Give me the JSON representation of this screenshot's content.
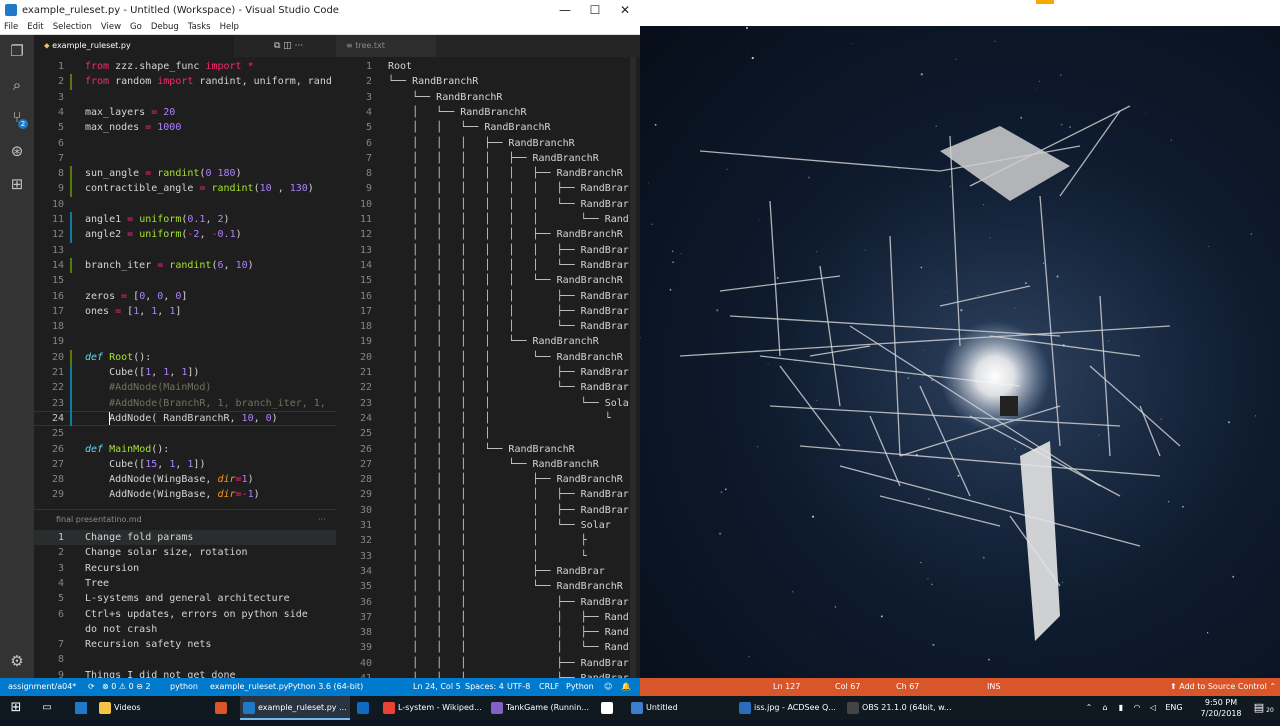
{
  "vscode": {
    "title": "example_ruleset.py - Untitled (Workspace) - Visual Studio Code",
    "win_buttons": [
      "—",
      "☐",
      "✕"
    ],
    "menu": [
      "File",
      "Edit",
      "Selection",
      "View",
      "Go",
      "Debug",
      "Tasks",
      "Help"
    ],
    "scm_badge": "2",
    "tabs": {
      "left": "example_ruleset.py",
      "right": "tree.txt",
      "left_actions": "⧉  ◫  ···"
    },
    "editor_lines": [
      {
        "n": "1",
        "t": [
          [
            "kw",
            "from "
          ],
          [
            "",
            "zzz.shape_func "
          ],
          [
            "kw",
            "import "
          ],
          [
            "kw",
            "*"
          ]
        ]
      },
      {
        "n": "2",
        "t": [
          [
            "kw",
            "from "
          ],
          [
            "",
            "random "
          ],
          [
            "kw",
            "import "
          ],
          [
            "",
            "randint, uniform, rand"
          ]
        ]
      },
      {
        "n": "3",
        "t": []
      },
      {
        "n": "4",
        "t": [
          [
            "",
            "max_layers "
          ],
          [
            "kw",
            "= "
          ],
          [
            "num",
            "20"
          ]
        ]
      },
      {
        "n": "5",
        "t": [
          [
            "",
            "max_nodes "
          ],
          [
            "kw",
            "= "
          ],
          [
            "num",
            "1000"
          ]
        ]
      },
      {
        "n": "6",
        "t": []
      },
      {
        "n": "7",
        "t": []
      },
      {
        "n": "8",
        "t": [
          [
            "",
            "sun_angle "
          ],
          [
            "kw",
            "= "
          ],
          [
            "fn",
            "randint"
          ],
          [
            "",
            "("
          ],
          [
            "num",
            "0"
          ],
          [
            ",",
            " "
          ],
          [
            "num",
            "180"
          ],
          [
            "",
            ")"
          ]
        ]
      },
      {
        "n": "9",
        "t": [
          [
            "",
            "contractible_angle "
          ],
          [
            "kw",
            "= "
          ],
          [
            "fn",
            "randint"
          ],
          [
            "",
            "("
          ],
          [
            "num",
            "10"
          ],
          [
            "",
            " , "
          ],
          [
            "num",
            "130"
          ],
          [
            "",
            ")"
          ]
        ]
      },
      {
        "n": "10",
        "t": []
      },
      {
        "n": "11",
        "t": [
          [
            "",
            "angle1 "
          ],
          [
            "kw",
            "= "
          ],
          [
            "fn",
            "uniform"
          ],
          [
            "",
            "("
          ],
          [
            "num",
            "0.1"
          ],
          [
            "",
            ", "
          ],
          [
            "num",
            "2"
          ],
          [
            "",
            ")"
          ]
        ]
      },
      {
        "n": "12",
        "t": [
          [
            "",
            "angle2 "
          ],
          [
            "kw",
            "= "
          ],
          [
            "fn",
            "uniform"
          ],
          [
            "",
            "("
          ],
          [
            "kw",
            "-"
          ],
          [
            "num",
            "2"
          ],
          [
            "",
            ", "
          ],
          [
            "kw",
            "-"
          ],
          [
            "num",
            "0.1"
          ],
          [
            "",
            ")"
          ]
        ]
      },
      {
        "n": "13",
        "t": []
      },
      {
        "n": "14",
        "t": [
          [
            "",
            "branch_iter "
          ],
          [
            "kw",
            "= "
          ],
          [
            "fn",
            "randint"
          ],
          [
            "",
            "("
          ],
          [
            "num",
            "6"
          ],
          [
            "",
            ", "
          ],
          [
            "num",
            "10"
          ],
          [
            "",
            ")"
          ]
        ]
      },
      {
        "n": "15",
        "t": []
      },
      {
        "n": "16",
        "t": [
          [
            "",
            "zeros "
          ],
          [
            "kw",
            "= "
          ],
          [
            "",
            "["
          ],
          [
            "num",
            "0"
          ],
          [
            "",
            ", "
          ],
          [
            "num",
            "0"
          ],
          [
            "",
            ", "
          ],
          [
            "num",
            "0"
          ],
          [
            "",
            "]"
          ]
        ]
      },
      {
        "n": "17",
        "t": [
          [
            "",
            "ones "
          ],
          [
            "kw",
            "= "
          ],
          [
            "",
            "["
          ],
          [
            "num",
            "1"
          ],
          [
            "",
            ", "
          ],
          [
            "num",
            "1"
          ],
          [
            "",
            ", "
          ],
          [
            "num",
            "1"
          ],
          [
            "",
            "]"
          ]
        ]
      },
      {
        "n": "18",
        "t": []
      },
      {
        "n": "19",
        "t": []
      },
      {
        "n": "20",
        "t": [
          [
            "df",
            "def "
          ],
          [
            "fn",
            "Root"
          ],
          [
            "",
            "():"
          ]
        ]
      },
      {
        "n": "21",
        "t": [
          [
            "",
            "    Cube(["
          ],
          [
            "num",
            "1"
          ],
          [
            "",
            ", "
          ],
          [
            "num",
            "1"
          ],
          [
            "",
            ", "
          ],
          [
            "num",
            "1"
          ],
          [
            "",
            "])"
          ]
        ]
      },
      {
        "n": "22",
        "t": [
          [
            "cm",
            "    #AddNode(MainMod)"
          ]
        ]
      },
      {
        "n": "23",
        "t": [
          [
            "cm",
            "    #AddNode(BranchR, 1, branch_iter, 1,"
          ]
        ]
      },
      {
        "n": "24",
        "t": [
          [
            "",
            "    AddNode( RandBranchR, "
          ],
          [
            "num",
            "10"
          ],
          [
            "",
            ", "
          ],
          [
            "num",
            "0"
          ],
          [
            "",
            ")"
          ]
        ]
      },
      {
        "n": "25",
        "t": []
      },
      {
        "n": "26",
        "t": [
          [
            "df",
            "def "
          ],
          [
            "fn",
            "MainMod"
          ],
          [
            "",
            "():"
          ]
        ]
      },
      {
        "n": "27",
        "t": [
          [
            "",
            "    Cube(["
          ],
          [
            "num",
            "15"
          ],
          [
            "",
            ", "
          ],
          [
            "num",
            "1"
          ],
          [
            "",
            ", "
          ],
          [
            "num",
            "1"
          ],
          [
            "",
            "])"
          ]
        ]
      },
      {
        "n": "28",
        "t": [
          [
            "",
            "    AddNode(WingBase, "
          ],
          [
            "pm",
            "dir"
          ],
          [
            "kw",
            "="
          ],
          [
            "num",
            "1"
          ],
          [
            "",
            ")"
          ]
        ]
      },
      {
        "n": "29",
        "t": [
          [
            "",
            "    AddNode(WingBase, "
          ],
          [
            "pm",
            "dir"
          ],
          [
            "kw",
            "=-"
          ],
          [
            "num",
            "1"
          ],
          [
            "",
            ")"
          ]
        ]
      }
    ],
    "md_panel": {
      "title": "final presentatino.md",
      "actions": "···",
      "lines": [
        {
          "n": "1",
          "t": "Change fold params"
        },
        {
          "n": "2",
          "t": "Change solar size, rotation"
        },
        {
          "n": "3",
          "t": "Recursion"
        },
        {
          "n": "4",
          "t": "Tree"
        },
        {
          "n": "5",
          "t": "L-systems and general architecture"
        },
        {
          "n": "6",
          "t": "Ctrl+s updates, errors on python side"
        },
        {
          "n": "",
          "t": "do not crash"
        },
        {
          "n": "7",
          "t": "Recursion safety nets"
        },
        {
          "n": "8",
          "t": ""
        },
        {
          "n": "9",
          "t": "Things I did not get done"
        }
      ]
    },
    "tree_lines": [
      {
        "n": "1",
        "p": "",
        "t": "Root"
      },
      {
        "n": "2",
        "p": "└── ",
        "t": "RandBranchR"
      },
      {
        "n": "3",
        "p": "    └── ",
        "t": "RandBranchR"
      },
      {
        "n": "4",
        "p": "    │   └── ",
        "t": "RandBranchR"
      },
      {
        "n": "5",
        "p": "    │   │   └── ",
        "t": "RandBranchR"
      },
      {
        "n": "6",
        "p": "    │   │   │   ├── ",
        "t": "RandBranchR"
      },
      {
        "n": "7",
        "p": "    │   │   │   │   ├── ",
        "t": "RandBranchR"
      },
      {
        "n": "8",
        "p": "    │   │   │   │   │   ├── ",
        "t": "RandBranchR"
      },
      {
        "n": "9",
        "p": "    │   │   │   │   │   │   ├── ",
        "t": "RandBrar"
      },
      {
        "n": "10",
        "p": "    │   │   │   │   │   │   └── ",
        "t": "RandBrar"
      },
      {
        "n": "11",
        "p": "    │   │   │   │   │   │       └── ",
        "t": "RandI"
      },
      {
        "n": "12",
        "p": "    │   │   │   │   │   ├── ",
        "t": "RandBranchR"
      },
      {
        "n": "13",
        "p": "    │   │   │   │   │   │   ├── ",
        "t": "RandBrar"
      },
      {
        "n": "14",
        "p": "    │   │   │   │   │   │   └── ",
        "t": "RandBrar"
      },
      {
        "n": "15",
        "p": "    │   │   │   │   │   └── ",
        "t": "RandBranchR"
      },
      {
        "n": "16",
        "p": "    │   │   │   │   │       ├── ",
        "t": "RandBrar"
      },
      {
        "n": "17",
        "p": "    │   │   │   │   │       ├── ",
        "t": "RandBrar"
      },
      {
        "n": "18",
        "p": "    │   │   │   │   │       └── ",
        "t": "RandBrar"
      },
      {
        "n": "19",
        "p": "    │   │   │   │   └── ",
        "t": "RandBranchR"
      },
      {
        "n": "20",
        "p": "    │   │   │   │       └── ",
        "t": "RandBranchR"
      },
      {
        "n": "21",
        "p": "    │   │   │   │           ├── ",
        "t": "RandBrar"
      },
      {
        "n": "22",
        "p": "    │   │   │   │           └── ",
        "t": "RandBrar"
      },
      {
        "n": "23",
        "p": "    │   │   │   │               └── ",
        "t": "Solar"
      },
      {
        "n": "24",
        "p": "    │   │   │   │                   └",
        "t": ""
      },
      {
        "n": "25",
        "p": "    │   │   │   │",
        "t": ""
      },
      {
        "n": "26",
        "p": "    │   │   │   └── ",
        "t": "RandBranchR"
      },
      {
        "n": "27",
        "p": "    │   │   │       └── ",
        "t": "RandBranchR"
      },
      {
        "n": "28",
        "p": "    │   │   │           ├── ",
        "t": "RandBranchR"
      },
      {
        "n": "29",
        "p": "    │   │   │           │   ├── ",
        "t": "RandBrar"
      },
      {
        "n": "30",
        "p": "    │   │   │           │   ├── ",
        "t": "RandBrar"
      },
      {
        "n": "31",
        "p": "    │   │   │           │   └── ",
        "t": "Solar"
      },
      {
        "n": "32",
        "p": "    │   │   │           │       ├",
        "t": ""
      },
      {
        "n": "33",
        "p": "    │   │   │           │       └",
        "t": ""
      },
      {
        "n": "34",
        "p": "    │   │   │           ├── ",
        "t": "RandBrar"
      },
      {
        "n": "35",
        "p": "    │   │   │           └── ",
        "t": "RandBranchR"
      },
      {
        "n": "36",
        "p": "    │   │   │               ├── ",
        "t": "RandBrar"
      },
      {
        "n": "37",
        "p": "    │   │   │               │   ├── ",
        "t": "RandI"
      },
      {
        "n": "38",
        "p": "    │   │   │               │   ├── ",
        "t": "RandI"
      },
      {
        "n": "39",
        "p": "    │   │   │               │   └── ",
        "t": "RandI"
      },
      {
        "n": "40",
        "p": "    │   │   │               ├── ",
        "t": "RandBrar"
      },
      {
        "n": "41",
        "p": "    │   │   │               └── ",
        "t": "RandBrar"
      }
    ],
    "status": {
      "branch": "assignment/a04*",
      "sync": "⟳",
      "problems": "⊗ 0 ⚠ 0 ⊖ 2",
      "lang_left": "python",
      "file": "example_ruleset.py",
      "interpreter": "Python 3.6 (64-bit)",
      "position": "Ln 24, Col 5",
      "spaces": "Spaces: 4",
      "encoding": "UTF-8",
      "eol": "CRLF",
      "lang": "Python",
      "face": "☺",
      "bell": "🔔"
    }
  },
  "viewer": {
    "status": {
      "ln": "Ln 127",
      "col": "Col 67",
      "ch": "Ch 67",
      "ins": "INS",
      "source_control": "⬆ Add to Source Control ⌃"
    }
  },
  "taskbar": {
    "items": [
      {
        "label": "Videos",
        "color": "#f4c542"
      },
      {
        "label": "",
        "color": "#d9552a"
      },
      {
        "label": "example_ruleset.py ...",
        "color": "#1e79c6"
      },
      {
        "label": "",
        "color": "#0f6ac1"
      },
      {
        "label": "L-system - Wikiped...",
        "color": "#e94235"
      },
      {
        "label": "TankGame (Runnin...",
        "color": "#865fc5"
      },
      {
        "label": "",
        "color": "#ffffff"
      },
      {
        "label": "Untitled",
        "color": "#3d7fcf"
      },
      {
        "label": "iss.jpg - ACDSee Q...",
        "color": "#2a6ebb"
      },
      {
        "label": "OBS 21.1.0 (64bit, w...",
        "color": "#444444"
      }
    ],
    "tray": {
      "arrows": "⌃",
      "lang": "ENG",
      "time": "9:50 PM",
      "date": "7/20/2018",
      "notif": "▤",
      "count": "20"
    }
  }
}
